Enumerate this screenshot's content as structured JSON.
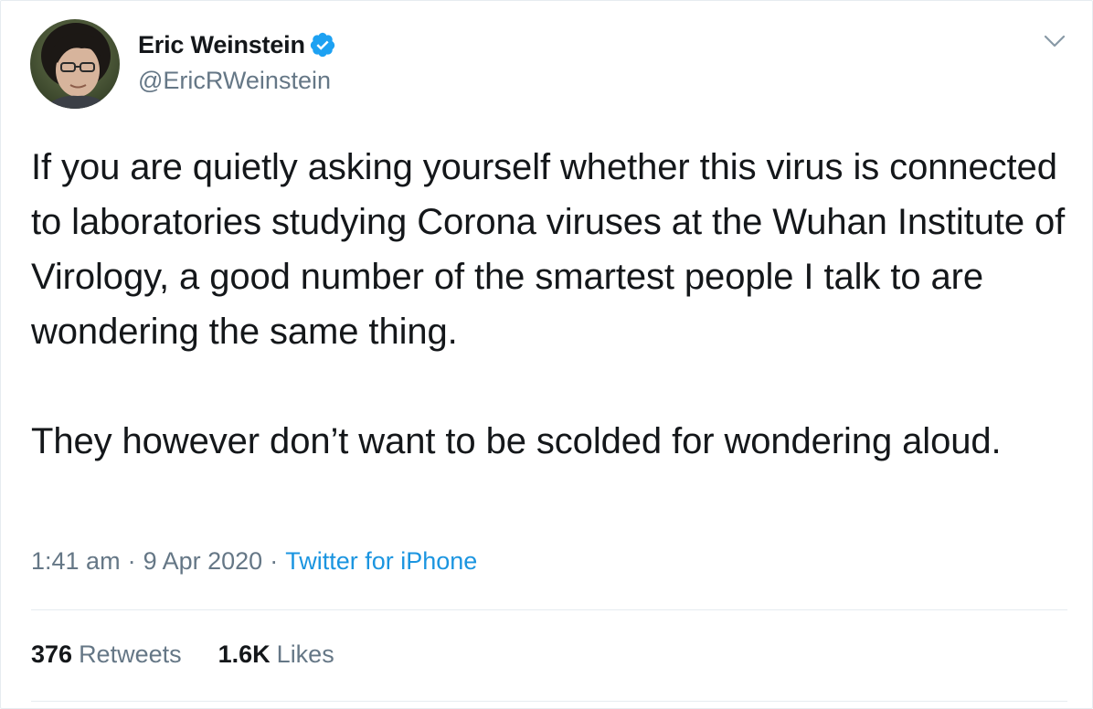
{
  "tweet": {
    "author": {
      "display_name": "Eric Weinstein",
      "handle": "@EricRWeinstein",
      "verified": true
    },
    "text": "If you are quietly asking yourself whether this virus is connected to laboratories studying Corona viruses at the Wuhan Institute of Virology, a good number of the smartest people I talk to are wondering the same thing.\n\nThey however don’t want to be scolded for wondering aloud.",
    "time": "1:41 am",
    "date": "9 Apr 2020",
    "separator": "·",
    "source": "Twitter for iPhone",
    "stats": {
      "retweets_count": "376",
      "retweets_label": "Retweets",
      "likes_count": "1.6K",
      "likes_label": "Likes"
    }
  },
  "icons": {
    "verified": "verified-badge-icon",
    "menu": "chevron-down-icon",
    "avatar": "profile-photo"
  },
  "colors": {
    "text_primary": "#14171a",
    "text_secondary": "#657786",
    "link": "#1b95e0",
    "verified": "#1da1f2",
    "divider": "#e6ecf0"
  }
}
